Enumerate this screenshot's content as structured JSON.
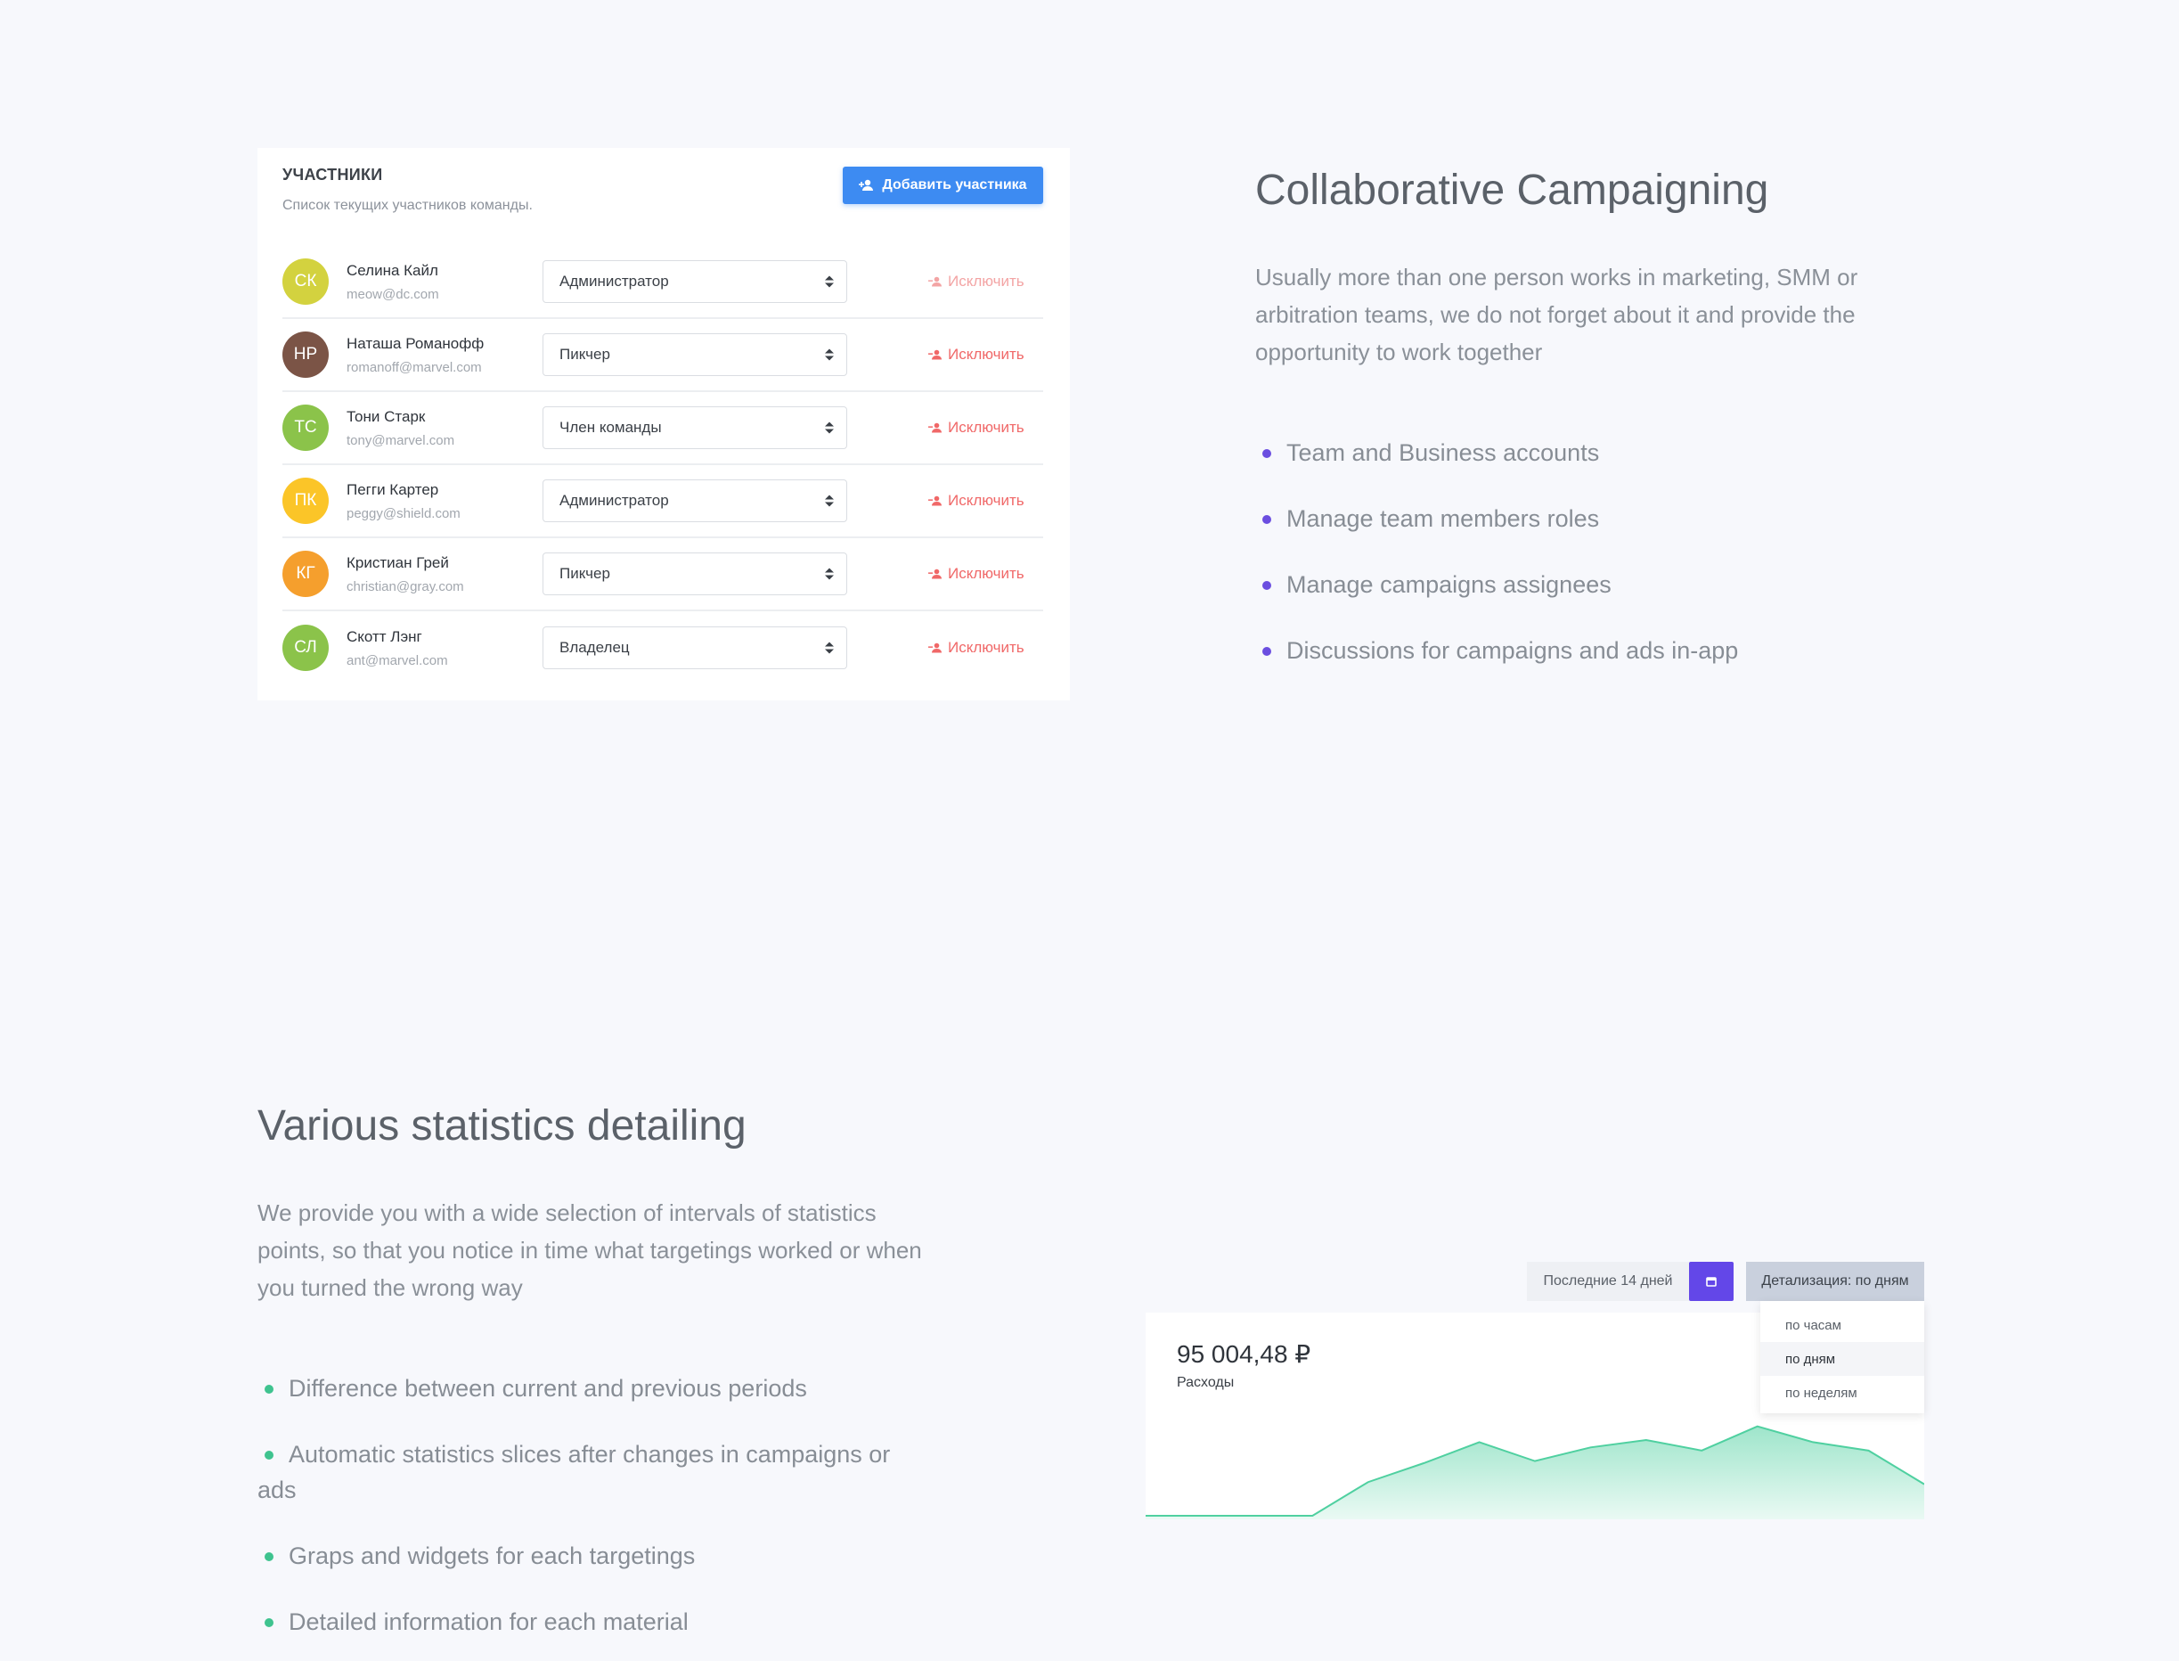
{
  "members": {
    "title": "УЧАСТНИКИ",
    "subtitle": "Список текущих участников команды.",
    "add_button": "Добавить участника",
    "remove_label": "Исключить",
    "list": [
      {
        "initials": "СК",
        "name": "Селина Кайл",
        "email": "meow@dc.com",
        "role": "Администратор",
        "color": "#d3d23f"
      },
      {
        "initials": "НР",
        "name": "Наташа Романофф",
        "email": "romanoff@marvel.com",
        "role": "Пикчер",
        "color": "#7b5446"
      },
      {
        "initials": "ТС",
        "name": "Тони Старк",
        "email": "tony@marvel.com",
        "role": "Член команды",
        "color": "#8bc34a"
      },
      {
        "initials": "ПК",
        "name": "Пегги Картер",
        "email": "peggy@shield.com",
        "role": "Администратор",
        "color": "#fbc528"
      },
      {
        "initials": "КГ",
        "name": "Кристиан Грей",
        "email": "christian@gray.com",
        "role": "Пикчер",
        "color": "#f59f2d"
      },
      {
        "initials": "СЛ",
        "name": "Скотт Лэнг",
        "email": "ant@marvel.com",
        "role": "Владелец",
        "color": "#8bc34a"
      }
    ]
  },
  "collab": {
    "title": "Collaborative Campaigning",
    "description": "Usually more than one person works in marketing, SMM or arbitration teams, we do not forget about it and provide the opportunity to work together",
    "bullets": [
      "Team and Business accounts",
      "Manage team members roles",
      "Manage campaigns assignees",
      "Discussions for campaigns and ads in-app"
    ],
    "bullet_color": "#6b4ee0"
  },
  "stats": {
    "title": "Various statistics detailing",
    "description": "We provide you with a wide selection of intervals of statistics points, so that you notice in time what targetings worked or when you turned the wrong way",
    "bullets": [
      "Difference between current and previous periods",
      "Automatic statistics slices after changes in campaigns or ads",
      "Graps and widgets for each targetings",
      "Detailed information for each material"
    ],
    "bullet_color": "#3fc38f"
  },
  "widget": {
    "period_label": "Последние 14 дней",
    "detail_label": "Детализация: по дням",
    "value": "95 004,48 ₽",
    "caption": "Расходы",
    "dropdown_options": [
      "по часам",
      "по дням",
      "по неделям"
    ],
    "dropdown_selected": 1,
    "accent": "#6347e8",
    "chart_color": "#4fd0a0"
  },
  "chart_data": {
    "type": "area",
    "title": "",
    "xlabel": "",
    "ylabel": "",
    "ylim": [
      0,
      100
    ],
    "values": [
      0,
      0,
      0,
      0,
      32,
      50,
      70,
      52,
      65,
      72,
      62,
      85,
      70,
      62,
      30
    ]
  }
}
